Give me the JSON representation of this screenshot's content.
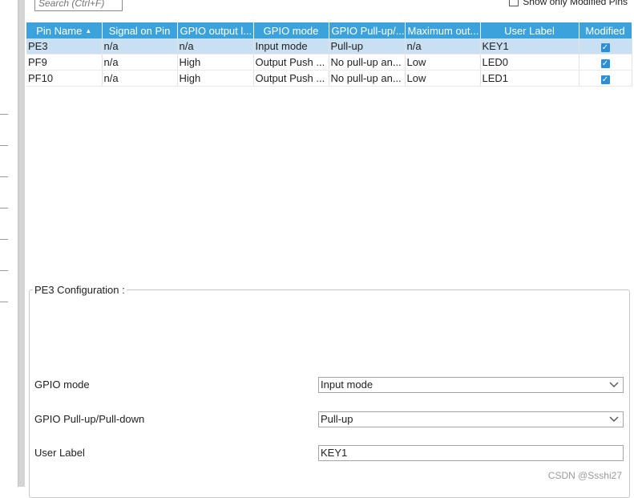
{
  "search": {
    "placeholder": "Search (Ctrl+F)"
  },
  "show_only_modified": {
    "label": "Show only Modified Pins",
    "checked": false
  },
  "table": {
    "columns": [
      "Pin Name",
      "Signal on Pin",
      "GPIO output l...",
      "GPIO mode",
      "GPIO Pull-up/...",
      "Maximum out...",
      "User Label",
      "Modified"
    ],
    "rows": [
      {
        "pin": "PE3",
        "signal": "n/a",
        "output": "n/a",
        "mode": "Input mode",
        "pull": "Pull-up",
        "speed": "n/a",
        "label": "KEY1",
        "modified": true,
        "selected": true
      },
      {
        "pin": "PF9",
        "signal": "n/a",
        "output": "High",
        "mode": "Output Push ...",
        "pull": "No pull-up an...",
        "speed": "Low",
        "label": "LED0",
        "modified": true,
        "selected": false
      },
      {
        "pin": "PF10",
        "signal": "n/a",
        "output": "High",
        "mode": "Output Push ...",
        "pull": "No pull-up an...",
        "speed": "Low",
        "label": "LED1",
        "modified": true,
        "selected": false
      }
    ]
  },
  "config": {
    "title": "PE3 Configuration :",
    "gpio_mode_label": "GPIO mode",
    "gpio_mode_value": "Input mode",
    "pull_label": "GPIO Pull-up/Pull-down",
    "pull_value": "Pull-up",
    "user_label_label": "User Label",
    "user_label_value": "KEY1"
  },
  "watermark": "CSDN @Ssshi27",
  "colors": {
    "header": "#3ca2dc",
    "selected_row": "#c9dff2",
    "checkbox": "#2a8fd7"
  }
}
